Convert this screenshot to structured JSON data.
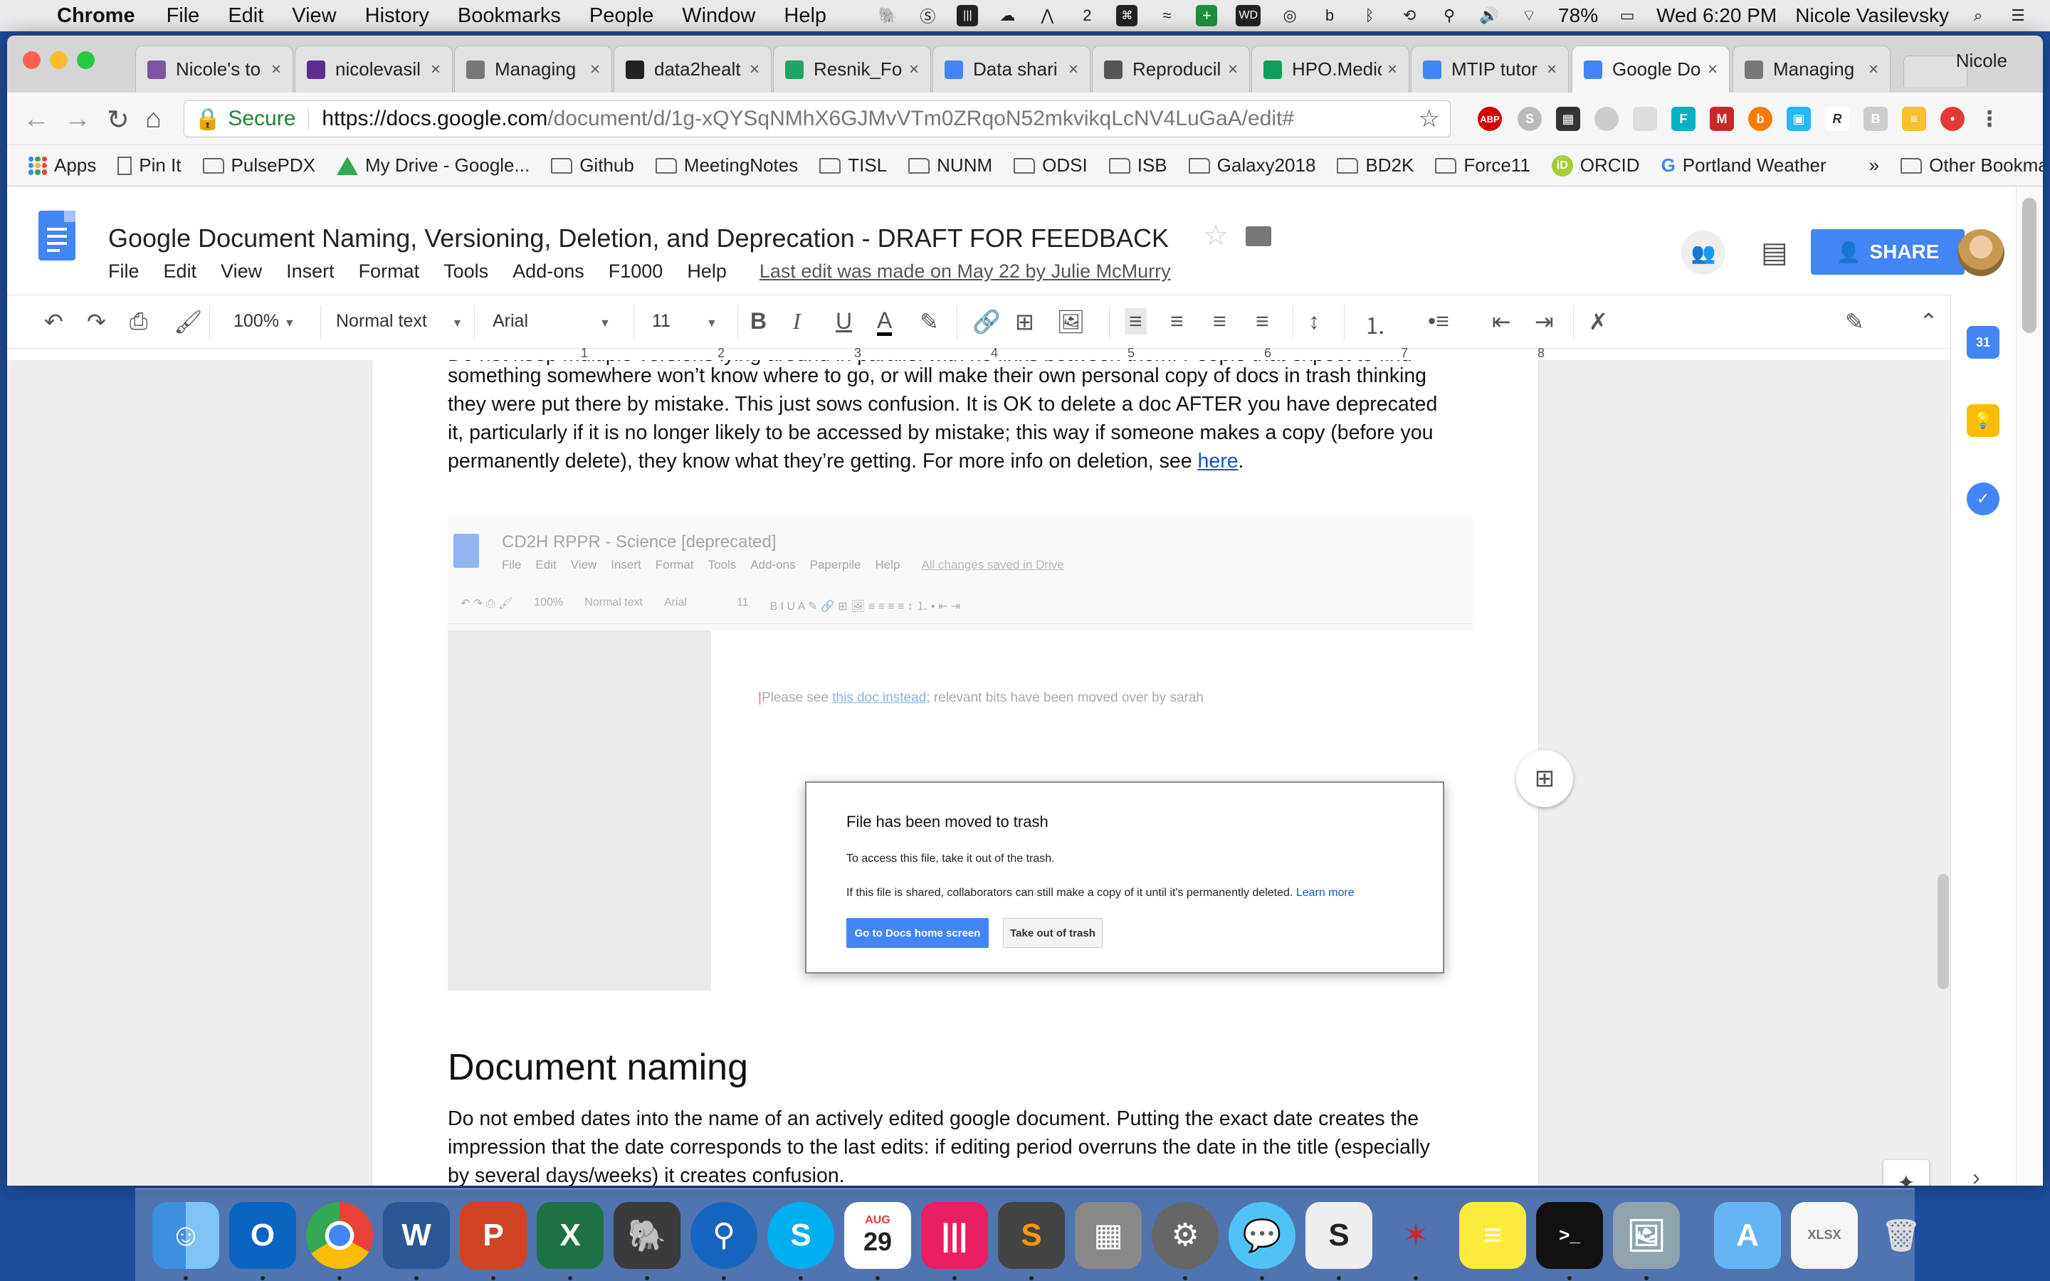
{
  "menubar": {
    "app_name": "Chrome",
    "menus": [
      "File",
      "Edit",
      "View",
      "History",
      "Bookmarks",
      "People",
      "Window",
      "Help"
    ],
    "badge_count": "2",
    "wd_label": "WD",
    "battery": "78%",
    "clock": "Wed 6:20 PM",
    "user": "Nicole Vasilevsky"
  },
  "tabs": [
    {
      "title": "Nicole's to",
      "color": "#7b55a2"
    },
    {
      "title": "nicolevasil",
      "color": "#5c2d91"
    },
    {
      "title": "Managing",
      "color": "#777777"
    },
    {
      "title": "data2healt",
      "color": "#222222"
    },
    {
      "title": "Resnik_Fol",
      "color": "#1fa463"
    },
    {
      "title": "Data shari",
      "color": "#4285f4"
    },
    {
      "title": "Reproducil",
      "color": "#555555"
    },
    {
      "title": "HPO.Medic",
      "color": "#0f9d58"
    },
    {
      "title": "MTIP tutor",
      "color": "#4285f4"
    },
    {
      "title": "Google Do",
      "color": "#4285f4",
      "active": true
    },
    {
      "title": "Managing",
      "color": "#777777"
    }
  ],
  "profile_name": "Nicole",
  "omnibox": {
    "secure_label": "Secure",
    "url_host": "https://docs.google.com",
    "url_path": "/document/d/1g-xQYSqNMhX6GJMvVTm0ZRqoN52mkvikqLcNV4LuGaA/edit#"
  },
  "bookmarks": [
    {
      "label": "Apps",
      "type": "apps"
    },
    {
      "label": "Pin It",
      "type": "page"
    },
    {
      "label": "PulsePDX",
      "type": "folder"
    },
    {
      "label": "My Drive - Google...",
      "type": "drive"
    },
    {
      "label": "Github",
      "type": "folder"
    },
    {
      "label": "MeetingNotes",
      "type": "folder"
    },
    {
      "label": "TISL",
      "type": "folder"
    },
    {
      "label": "NUNM",
      "type": "folder"
    },
    {
      "label": "ODSI",
      "type": "folder"
    },
    {
      "label": "ISB",
      "type": "folder"
    },
    {
      "label": "Galaxy2018",
      "type": "folder"
    },
    {
      "label": "BD2K",
      "type": "folder"
    },
    {
      "label": "Force11",
      "type": "folder"
    },
    {
      "label": "ORCID",
      "type": "orcid"
    },
    {
      "label": "Portland Weather",
      "type": "google"
    }
  ],
  "bookmarks_overflow": "»",
  "other_bookmarks": "Other Bookmarks",
  "doc": {
    "title": "Google Document Naming, Versioning, Deletion, and Deprecation - DRAFT FOR FEEDBACK",
    "menus": [
      "File",
      "Edit",
      "View",
      "Insert",
      "Format",
      "Tools",
      "Add-ons",
      "F1000",
      "Help"
    ],
    "last_edit": "Last edit was made on May 22 by Julie McMurry",
    "share_label": "SHARE"
  },
  "toolbar": {
    "zoom": "100%",
    "style": "Normal text",
    "font": "Arial",
    "size": "11"
  },
  "ruler_numbers": [
    "1",
    "2",
    "3",
    "4",
    "5",
    "6",
    "7",
    "8"
  ],
  "body": {
    "line0": "Do not keep multiple versions lying around in parallel with no links between them. People that expect to find",
    "line1": "something somewhere won’t know where to go, or will make their own personal copy of docs in trash thinking",
    "line2": "they were put there by mistake. This just sows confusion. It is OK to delete a doc AFTER you have deprecated",
    "line3": "it, particularly if it is no longer likely to be accessed by mistake; this way if someone makes a copy (before you",
    "line4_pre": "permanently delete), they know what they’re getting. For more info on deletion, see ",
    "line4_link": "here",
    "line4_post": "."
  },
  "embed": {
    "title": "CD2H RPPR - Science [deprecated]",
    "menus": [
      "File",
      "Edit",
      "View",
      "Insert",
      "Format",
      "Tools",
      "Add-ons",
      "Paperpile",
      "Help"
    ],
    "saved": "All changes saved in Drive",
    "zoom": "100%",
    "style": "Normal text",
    "font": "Arial",
    "size": "11",
    "note_pre": "Please see ",
    "note_link": "this doc instead",
    "note_post": "; relevant bits have been moved over by sarah",
    "dialog": {
      "title": "File has been moved to trash",
      "line1": "To access this file, take it out of the trash.",
      "line2": "If this file is shared, collaborators can still make a copy of it until it's permanently deleted.",
      "learn_more": "Learn more",
      "primary_button": "Go to Docs home screen",
      "secondary_button": "Take out of trash"
    }
  },
  "section": {
    "heading": "Document naming",
    "p1": "Do not embed dates into the name of an actively edited google document. Putting the exact date creates the",
    "p2": "impression that the date corresponds to the last edits: if editing period overruns the date in the title (especially",
    "p3": "by several days/weeks) it creates confusion."
  },
  "sidepanel": {
    "calendar_label": "31"
  },
  "dock": {
    "calendar_month": "AUG",
    "calendar_day": "29"
  }
}
